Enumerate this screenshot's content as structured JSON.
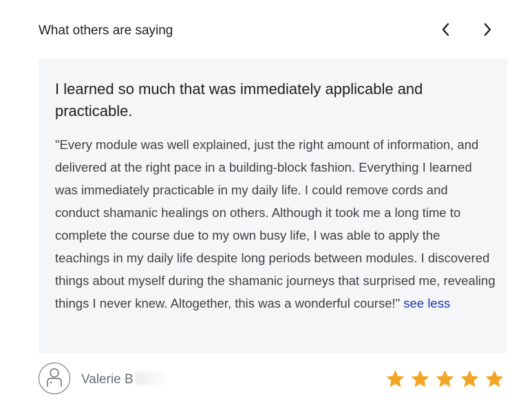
{
  "header": {
    "title": "What others are saying",
    "prev_icon": "chevron-left-icon",
    "next_icon": "chevron-right-icon"
  },
  "review": {
    "title": "I learned so much that was immediately applicable and practicable.",
    "body": "\"Every module was well explained, just the right amount of information, and delivered at the right pace in a building-block fashion. Everything I learned was immediately practicable in my daily life. I could remove cords and conduct shamanic healings on others. Although it took me a long time to complete the course due to my own busy life, I was able to apply the teachings in my daily life despite long periods between modules. I discovered things about myself during the shamanic journeys that surprised me, revealing things I never knew. Altogether, this was a wonderful course!\"",
    "toggle_label": "see less"
  },
  "reviewer": {
    "name": "Valerie B",
    "avatar_icon": "user-avatar-icon"
  },
  "rating": {
    "stars": 5,
    "max": 5,
    "star_color": "#f3a626"
  },
  "colors": {
    "card_background": "#f5f6f8",
    "link": "#1f37a8"
  }
}
